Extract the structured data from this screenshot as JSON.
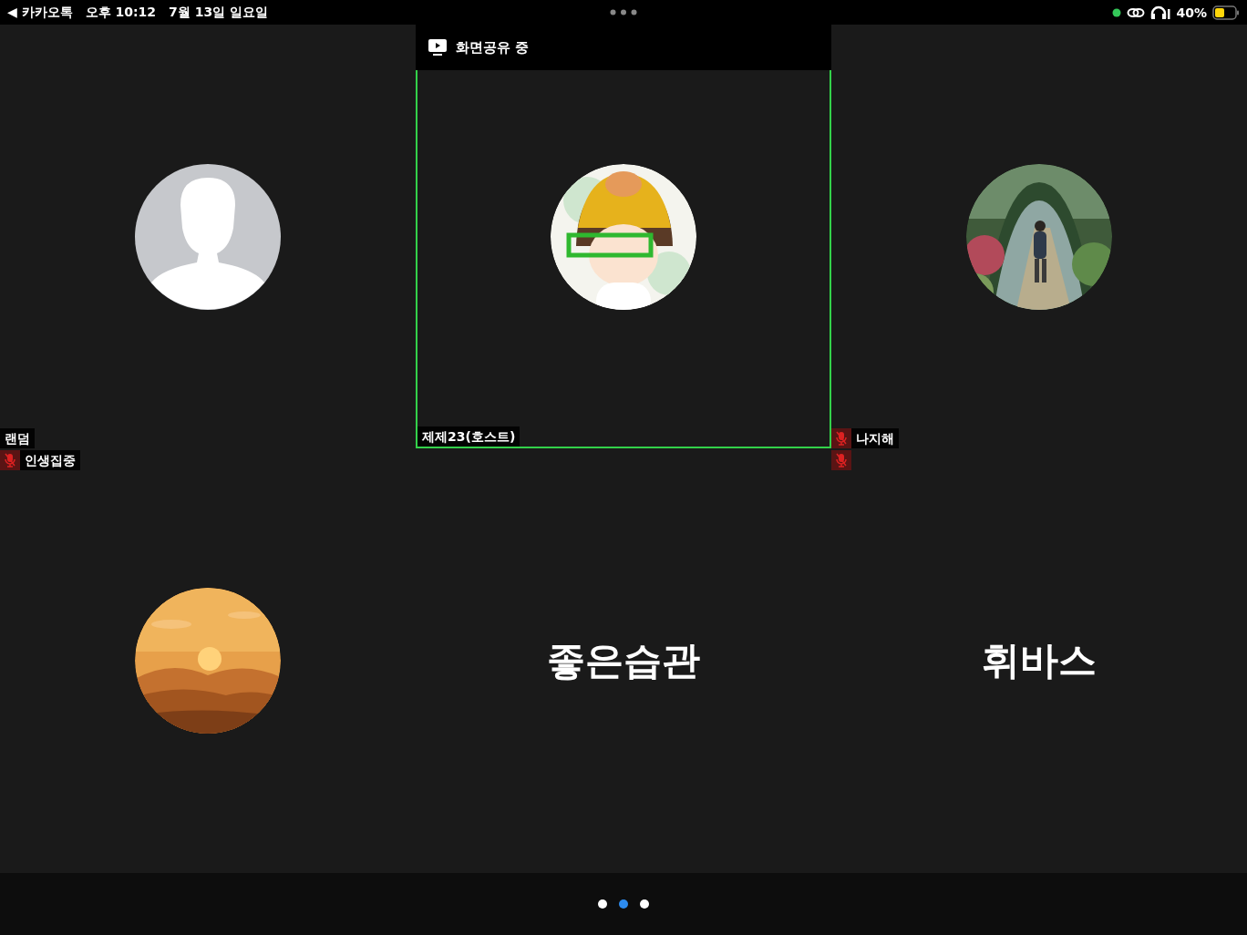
{
  "status_bar": {
    "back_app": "◀ 카카오톡",
    "time": "오후 10:12",
    "date": "7월 13일 일요일",
    "battery": "40%"
  },
  "share_banner": {
    "text": "화면공유 중"
  },
  "tiles": [
    {
      "label": "랜덤",
      "muted": false,
      "speaking": false,
      "avatar": {
        "kind": "silhouette"
      }
    },
    {
      "label": "제제23(호스트)",
      "muted": false,
      "speaking": true
    },
    {
      "label": "나지해",
      "muted": true,
      "speaking": false
    },
    {
      "label": "인생집중",
      "muted": true,
      "speaking": false
    },
    {
      "muted": false,
      "speaking": false,
      "avatar": {
        "kind": "name",
        "text": "좋은습관"
      }
    },
    {
      "muted": true,
      "speaking": false,
      "avatar": {
        "kind": "name",
        "text": "휘바스"
      }
    }
  ],
  "pages": [
    {
      "selected": false
    },
    {
      "selected": true
    },
    {
      "selected": false
    }
  ]
}
